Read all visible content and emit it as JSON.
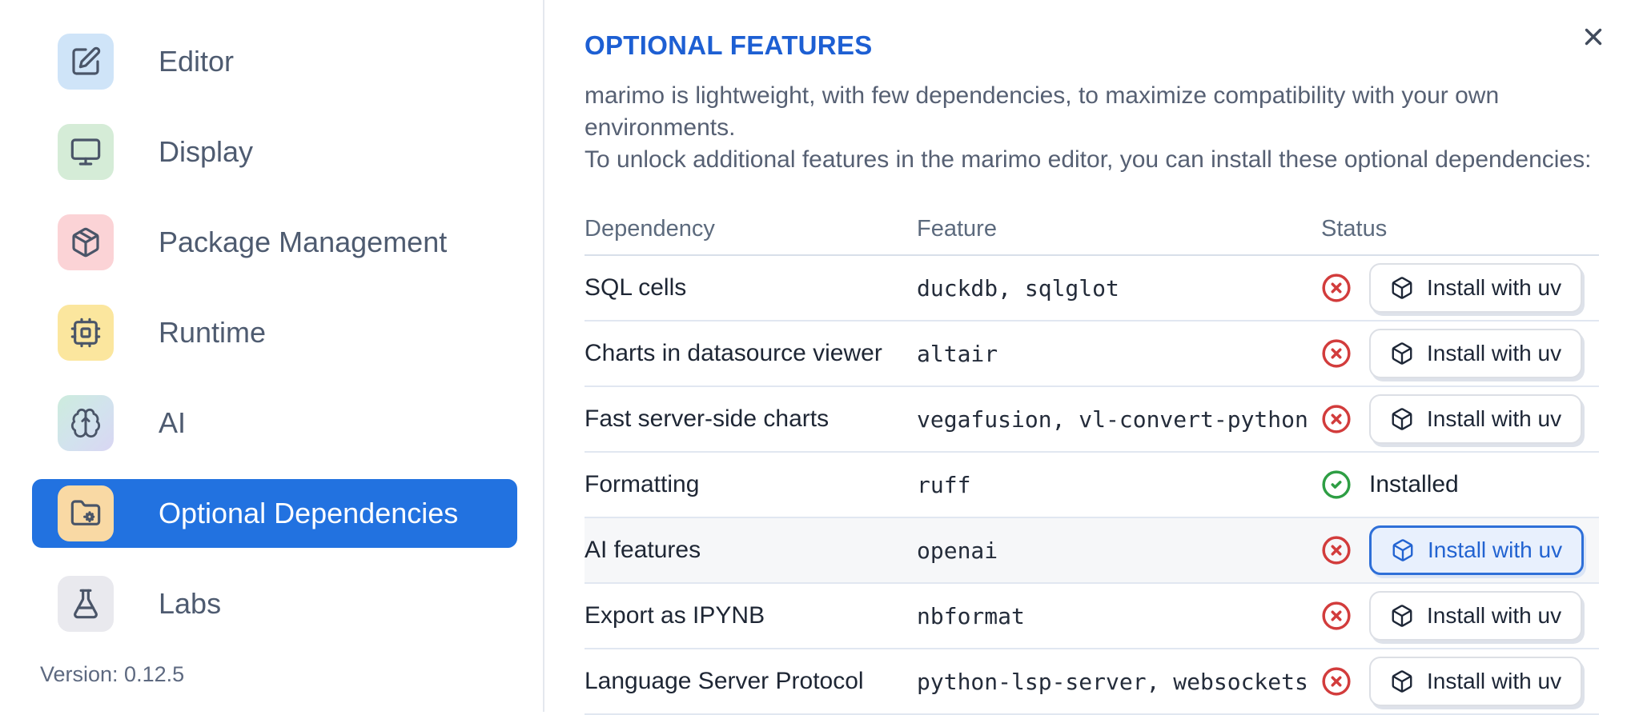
{
  "sidebar": {
    "items": [
      {
        "label": "Editor",
        "icon": "square-pen",
        "tile_bg": "#cfe4f8",
        "selected": false
      },
      {
        "label": "Display",
        "icon": "monitor",
        "tile_bg": "#d5ecd7",
        "selected": false
      },
      {
        "label": "Package Management",
        "icon": "package",
        "tile_bg": "#fbd3d6",
        "selected": false
      },
      {
        "label": "Runtime",
        "icon": "cpu",
        "tile_bg": "#fbe69e",
        "selected": false
      },
      {
        "label": "AI",
        "icon": "brain",
        "tile_bg": "linear-gradient(135deg,#cdecdd 0%,#d2e2ee 55%,#d9d6f3 100%)",
        "selected": false
      },
      {
        "label": "Optional Dependencies",
        "icon": "folder-cog",
        "tile_bg": "#f9d9a4",
        "selected": true
      },
      {
        "label": "Labs",
        "icon": "flask",
        "tile_bg": "#e9e9ee",
        "selected": false
      }
    ],
    "version_label": "Version: 0.12.5"
  },
  "dialog": {
    "title": "OPTIONAL FEATURES",
    "description_line1": "marimo is lightweight, with few dependencies, to maximize compatibility with your own environments.",
    "description_line2": "To unlock additional features in the marimo editor, you can install these optional dependencies:",
    "close_icon": "close-x"
  },
  "table": {
    "headers": {
      "dependency": "Dependency",
      "feature": "Feature",
      "status": "Status"
    },
    "rows": [
      {
        "dependency": "SQL cells",
        "feature": "duckdb, sqlglot",
        "installed": false,
        "action": "Install with uv",
        "highlighted": false
      },
      {
        "dependency": "Charts in datasource viewer",
        "feature": "altair",
        "installed": false,
        "action": "Install with uv",
        "highlighted": false
      },
      {
        "dependency": "Fast server-side charts",
        "feature": "vegafusion, vl-convert-python",
        "installed": false,
        "action": "Install with uv",
        "highlighted": false
      },
      {
        "dependency": "Formatting",
        "feature": "ruff",
        "installed": true,
        "status_text": "Installed",
        "highlighted": false
      },
      {
        "dependency": "AI features",
        "feature": "openai",
        "installed": false,
        "action": "Install with uv",
        "highlighted": true
      },
      {
        "dependency": "Export as IPYNB",
        "feature": "nbformat",
        "installed": false,
        "action": "Install with uv",
        "highlighted": false
      },
      {
        "dependency": "Language Server Protocol",
        "feature": "python-lsp-server, websockets",
        "installed": false,
        "action": "Install with uv",
        "highlighted": false
      }
    ]
  },
  "colors": {
    "accent_blue": "#2272e0",
    "title_blue": "#1d5fd3",
    "error_red": "#d23c3c",
    "success_green": "#2e9e44",
    "highlight_button_bg": "#e8f0fd",
    "highlight_button_border": "#2e6fd8",
    "row_highlight_bg": "#f6f7f9"
  }
}
